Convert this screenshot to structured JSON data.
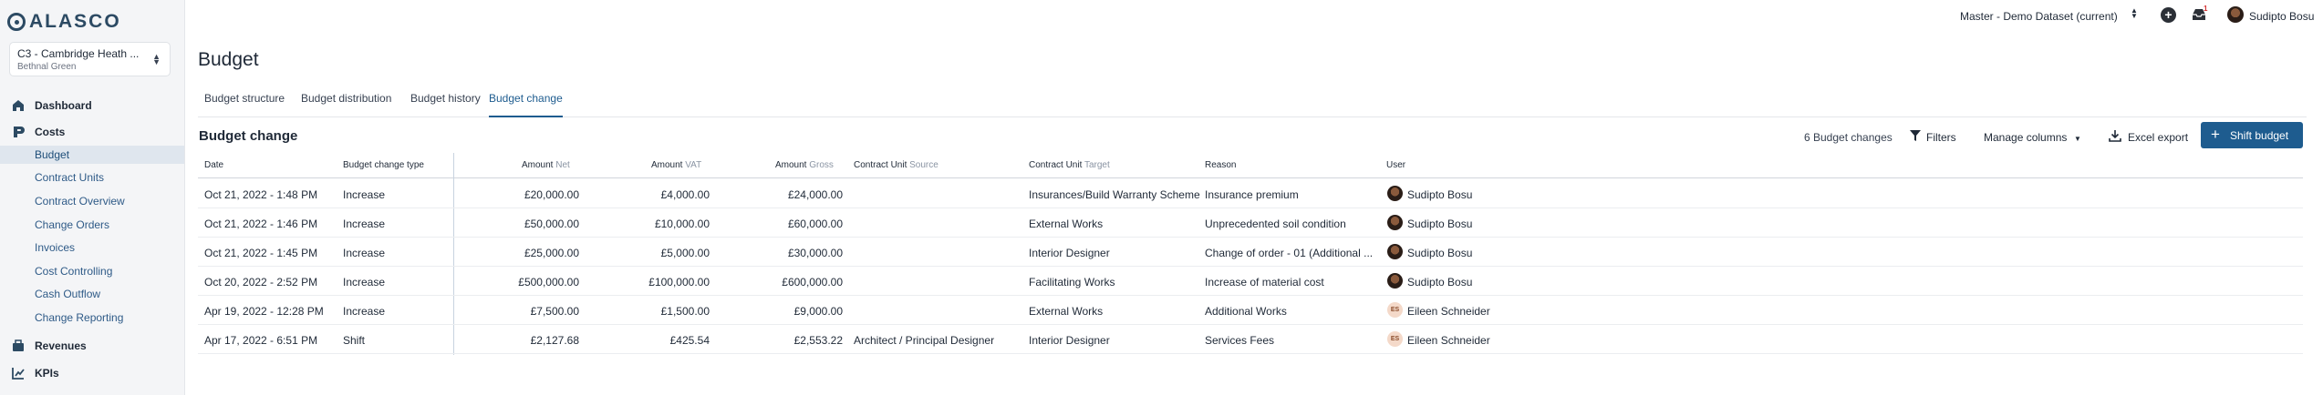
{
  "app": {
    "logo_text": "ALASCO"
  },
  "project": {
    "name": "C3 - Cambridge Heath ...",
    "owner": "Bethnal Green"
  },
  "nav": {
    "dashboard": "Dashboard",
    "costs": "Costs",
    "cost_items": [
      "Budget",
      "Contract Units",
      "Contract Overview",
      "Change Orders",
      "Invoices",
      "Cost Controlling",
      "Cash Outflow",
      "Change Reporting"
    ],
    "revenues": "Revenues",
    "kpis": "KPIs"
  },
  "topbar": {
    "dataset": "Master - Demo Dataset (current)",
    "notification_count": "1",
    "user_name": "Sudipto Bosu"
  },
  "page": {
    "title": "Budget"
  },
  "tabs": [
    "Budget structure",
    "Budget distribution",
    "Budget history",
    "Budget change"
  ],
  "section": {
    "title": "Budget change",
    "count": "6 Budget changes",
    "filters_label": "Filters",
    "manage_columns_label": "Manage columns",
    "export_label": "Excel export",
    "shift_label": "Shift budget"
  },
  "table": {
    "headers": {
      "date": "Date",
      "type": "Budget change type",
      "amount_net": {
        "main": "Amount",
        "sub": "Net"
      },
      "amount_vat": {
        "main": "Amount",
        "sub": "VAT"
      },
      "amount_gross": {
        "main": "Amount",
        "sub": "Gross"
      },
      "cu_source": {
        "main": "Contract Unit",
        "sub": "Source"
      },
      "cu_target": {
        "main": "Contract Unit",
        "sub": "Target"
      },
      "reason": "Reason",
      "user": "User"
    },
    "rows": [
      {
        "date": "Oct 21, 2022 - 1:48 PM",
        "type": "Increase",
        "net": "£20,000.00",
        "vat": "£4,000.00",
        "gross": "£24,000.00",
        "source": "",
        "target": "Insurances/Build Warranty Scheme",
        "reason": "Insurance premium",
        "user": "Sudipto Bosu",
        "initials": ""
      },
      {
        "date": "Oct 21, 2022 - 1:46 PM",
        "type": "Increase",
        "net": "£50,000.00",
        "vat": "£10,000.00",
        "gross": "£60,000.00",
        "source": "",
        "target": "External Works",
        "reason": "Unprecedented soil condition",
        "user": "Sudipto Bosu",
        "initials": ""
      },
      {
        "date": "Oct 21, 2022 - 1:45 PM",
        "type": "Increase",
        "net": "£25,000.00",
        "vat": "£5,000.00",
        "gross": "£30,000.00",
        "source": "",
        "target": "Interior Designer",
        "reason": "Change of order - 01 (Additional ...",
        "user": "Sudipto Bosu",
        "initials": ""
      },
      {
        "date": "Oct 20, 2022 - 2:52 PM",
        "type": "Increase",
        "net": "£500,000.00",
        "vat": "£100,000.00",
        "gross": "£600,000.00",
        "source": "",
        "target": "Facilitating Works",
        "reason": "Increase of material cost",
        "user": "Sudipto Bosu",
        "initials": ""
      },
      {
        "date": "Apr 19, 2022 - 12:28 PM",
        "type": "Increase",
        "net": "£7,500.00",
        "vat": "£1,500.00",
        "gross": "£9,000.00",
        "source": "",
        "target": "External Works",
        "reason": "Additional Works",
        "user": "Eileen Schneider",
        "initials": "ES"
      },
      {
        "date": "Apr 17, 2022 - 6:51 PM",
        "type": "Shift",
        "net": "£2,127.68",
        "vat": "£425.54",
        "gross": "£2,553.22",
        "source": "Architect / Principal Designer",
        "target": "Interior Designer",
        "reason": "Services Fees",
        "user": "Eileen Schneider",
        "initials": "ES"
      }
    ]
  }
}
